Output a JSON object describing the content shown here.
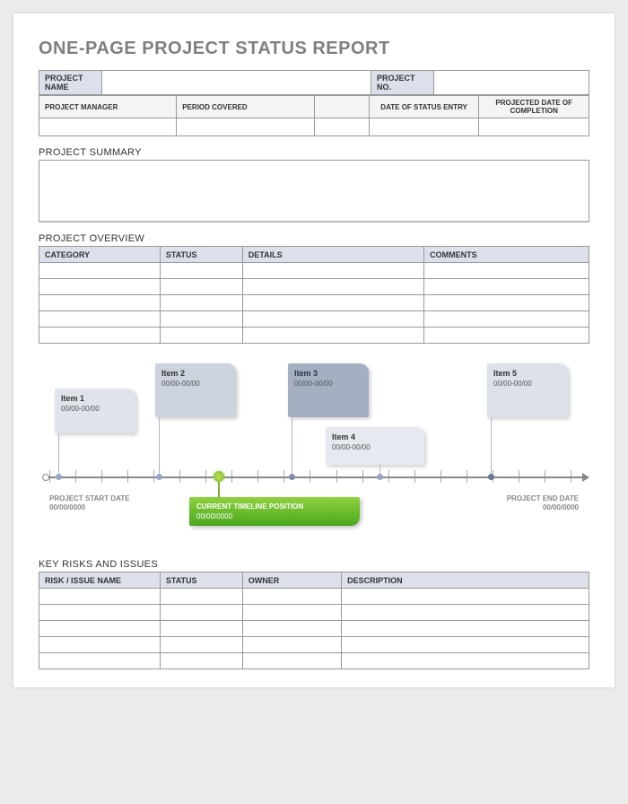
{
  "title": "ONE-PAGE PROJECT STATUS REPORT",
  "info": {
    "project_name_lbl": "PROJECT NAME",
    "project_name_val": "",
    "project_no_lbl": "PROJECT NO.",
    "project_no_val": "",
    "pm_lbl": "PROJECT MANAGER",
    "period_lbl": "PERIOD COVERED",
    "entry_lbl": "DATE OF STATUS ENTRY",
    "completion_lbl": "PROJECTED DATE OF COMPLETION"
  },
  "sections": {
    "summary": "PROJECT SUMMARY",
    "overview": "PROJECT OVERVIEW",
    "risks": "KEY RISKS AND ISSUES"
  },
  "overview_cols": {
    "cat": "CATEGORY",
    "status": "STATUS",
    "details": "DETAILS",
    "comments": "COMMENTS"
  },
  "risks_cols": {
    "name": "RISK / ISSUE NAME",
    "status": "STATUS",
    "owner": "OWNER",
    "desc": "DESCRIPTION"
  },
  "timeline": {
    "items": [
      {
        "name": "Item 1",
        "date": "00/00-00/00"
      },
      {
        "name": "Item 2",
        "date": "00/00-00/00"
      },
      {
        "name": "Item 3",
        "date": "00/00-00/00"
      },
      {
        "name": "Item 4",
        "date": "00/00-00/00"
      },
      {
        "name": "Item 5",
        "date": "00/00-00/00"
      }
    ],
    "start_lbl": "PROJECT START DATE",
    "start_date": "00/00/0000",
    "end_lbl": "PROJECT END DATE",
    "end_date": "00/00/0000",
    "current_lbl": "CURRENT TIMELINE POSITION",
    "current_date": "00/00/0000"
  }
}
